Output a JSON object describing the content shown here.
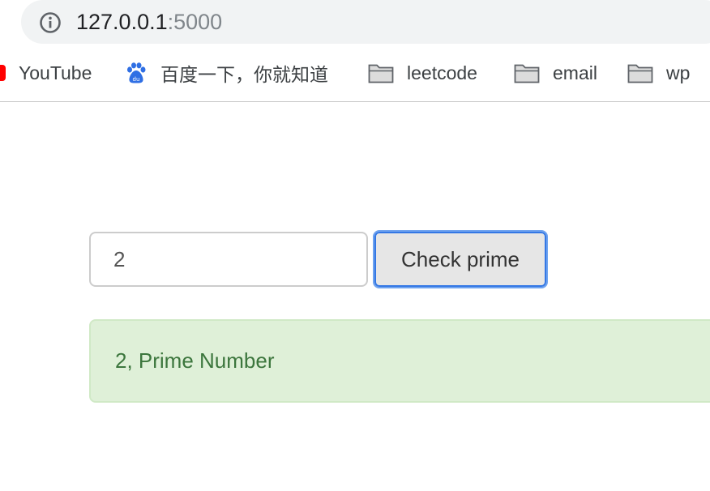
{
  "browser": {
    "url_host": "127.0.0.1",
    "url_port": ":5000"
  },
  "bookmarks": [
    {
      "label": "YouTube",
      "icon": "youtube-icon"
    },
    {
      "label": "百度一下，你就知道",
      "icon": "baidu-paw-icon"
    },
    {
      "label": "leetcode",
      "icon": "folder-icon"
    },
    {
      "label": "email",
      "icon": "folder-icon"
    },
    {
      "label": "wp",
      "icon": "folder-icon"
    }
  ],
  "form": {
    "input_value": "2",
    "button_label": "Check prime"
  },
  "result": {
    "message": "2, Prime Number"
  },
  "colors": {
    "alert_bg": "#dff0d8",
    "alert_text": "#3c763d",
    "button_focus": "#3478e5"
  }
}
